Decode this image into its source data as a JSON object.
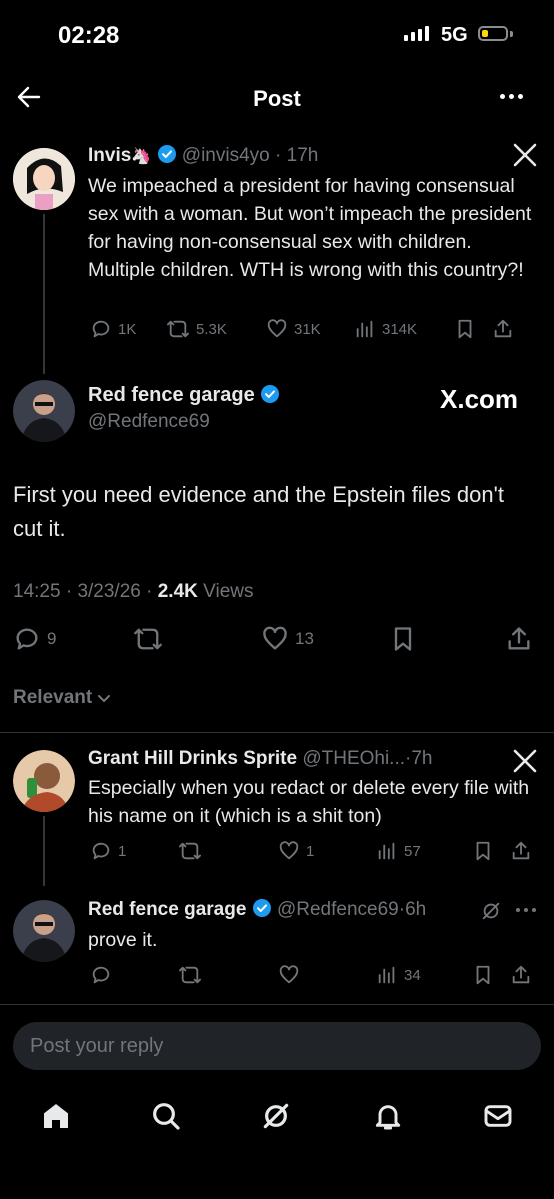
{
  "status": {
    "time": "02:28",
    "network": "5G",
    "battery_level": 0.25,
    "battery_color": "#ffd60a"
  },
  "header": {
    "title": "Post"
  },
  "original": {
    "name": "Invis",
    "emoji": "🦄",
    "handle": "@invis4yo",
    "dot": "·",
    "age": "17h",
    "text": "We impeached a president for having consensual sex with a woman. But won’t impeach the president for having non-consensual sex with children. Multiple children. WTH is wrong with this country?!",
    "replies": "1K",
    "reposts": "5.3K",
    "likes": "31K",
    "views": "314K"
  },
  "main": {
    "name": "Red fence garage",
    "handle": "@Redfence69",
    "brand": "X.com",
    "text": "First you need evidence and the Epstein files don't cut it.",
    "time": "14:25",
    "dot1": "·",
    "date": "3/23/26",
    "dot2": "·",
    "views_count": "2.4K",
    "views_label": "Views",
    "replies": "9",
    "likes": "13"
  },
  "sort": {
    "label": "Relevant"
  },
  "reply1": {
    "name": "Grant Hill Drinks Sprite",
    "handle": "@THEOhi...",
    "dot": "·",
    "age": "7h",
    "text": "Especially when you redact or delete every file with his name on it (which is a shit ton)",
    "replies": "1",
    "likes": "1",
    "views": "57"
  },
  "reply2": {
    "name": "Red fence garage",
    "handle": "@Redfence69",
    "dot": "·",
    "age": "6h",
    "text": "prove it.",
    "views": "34"
  },
  "composer": {
    "placeholder": "Post your reply"
  },
  "colors": {
    "accent": "#1d9bf0",
    "muted": "#71767b",
    "background": "#000000"
  },
  "tabbar": {
    "icons": [
      "home-icon",
      "search-icon",
      "grok-icon",
      "notifications-icon",
      "messages-icon"
    ]
  }
}
